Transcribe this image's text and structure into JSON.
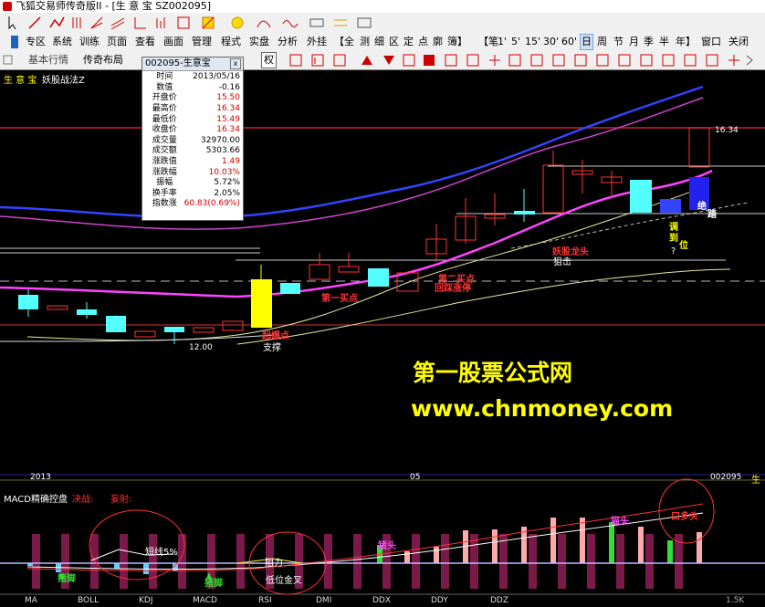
{
  "window": {
    "title": "飞狐交易师传奇版II - [生 意 宝 SZ002095]"
  },
  "menu": {
    "items": [
      "专区",
      "系统",
      "训练",
      "页面",
      "查看",
      "画面",
      "管理",
      "程式",
      "实盘",
      "分析",
      "外挂",
      "【全",
      "测",
      "细",
      "区",
      "定",
      "点",
      "廓",
      "簿】",
      "【笔",
      "1'",
      "5'",
      "15'",
      "30'",
      "60'",
      "日",
      "周",
      "节",
      "月",
      "季",
      "半",
      "年】",
      "窗口",
      "关闭"
    ]
  },
  "toolbar": {
    "basic_tab": "基本行情",
    "legend_tab": "传奇布局",
    "quan_button": "权"
  },
  "chart_header": {
    "stock_name": "生 意 宝",
    "formula": "妖股战法Z"
  },
  "popup": {
    "title": "002095-生意宝",
    "close": "x",
    "rows": [
      {
        "k": "时间",
        "v": "2013/05/16",
        "red": false
      },
      {
        "k": "数值",
        "v": "-0.16",
        "red": false
      },
      {
        "k": "开盘价",
        "v": "15.50",
        "red": true
      },
      {
        "k": "最高价",
        "v": "16.34",
        "red": true
      },
      {
        "k": "最低价",
        "v": "15.49",
        "red": true
      },
      {
        "k": "收盘价",
        "v": "16.34",
        "red": true
      },
      {
        "k": "成交量",
        "v": "32970.00",
        "red": false
      },
      {
        "k": "成交额",
        "v": "5303.66",
        "red": false
      },
      {
        "k": "涨跌值",
        "v": "1.49",
        "red": true
      },
      {
        "k": "涨跌幅",
        "v": "10.03%",
        "red": true
      },
      {
        "k": "振幅",
        "v": "5.72%",
        "red": false
      },
      {
        "k": "换手率",
        "v": "2.05%",
        "red": false
      },
      {
        "k": "指数涨",
        "v": "60.83(0.69%)",
        "red": true
      }
    ]
  },
  "annotations": {
    "price_high": "16.34",
    "price_low": "12.00",
    "buy1": "第一买点",
    "buy2a": "第二买点",
    "buy2b": "回踩涨停",
    "boom": "起爆点",
    "support": "支撑",
    "ambush": "狙击",
    "dragon": "妖股龙头",
    "jue": "绝",
    "ta": "踏",
    "tiao": "调",
    "dao": "到",
    "wei": "位",
    "q": "?",
    "watermark1": "第一股票公式网",
    "watermark2": "www.chnmoney.com",
    "year": "2013",
    "month": "05",
    "code": "002095",
    "sheng": "生"
  },
  "macd_panel": {
    "title": "MACD精确控盘",
    "t2": "决战:",
    "t3": "妄射:",
    "low_pos": "短线5%",
    "zhu_jiao1": "猪脚",
    "zhu_jiao2": "猪脚",
    "resist": "阻力",
    "low_gold": "低位金叉",
    "zhong_tou": "猪头",
    "mao_tou": "猫头",
    "duo_tou": "口多头"
  },
  "bottom_tabs": [
    "MA",
    "BOLL",
    "KDJ",
    "MACD",
    "RSI",
    "DMI",
    "DDX",
    "DDY",
    "DDZ"
  ],
  "bottom_right": "1.5K",
  "colors": {
    "up": "#ff3333",
    "down": "#54ffff",
    "yellow": "#ffff00",
    "ma_pink": "#ff44ff",
    "ma_blue": "#3344ff"
  }
}
